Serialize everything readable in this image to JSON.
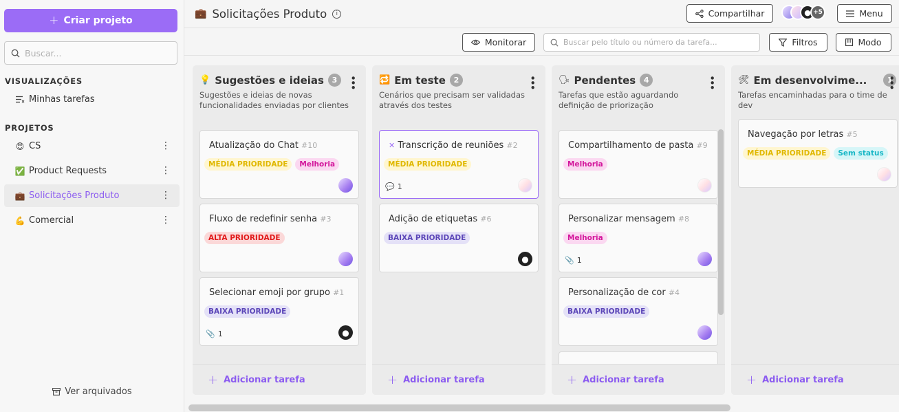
{
  "sidebar": {
    "create_label": "Criar projeto",
    "search_placeholder": "Buscar...",
    "views_label": "VISUALIZAÇÕES",
    "views": [
      {
        "label": "Minhas tarefas",
        "icon": "list-icon"
      }
    ],
    "projects_label": "PROJETOS",
    "projects": [
      {
        "label": "CS",
        "icon": "😍"
      },
      {
        "label": "Product Requests",
        "icon": "✅"
      },
      {
        "label": "Solicitações Produto",
        "icon": "💼",
        "active": true
      },
      {
        "label": "Comercial",
        "icon": "💪"
      }
    ],
    "archive_label": "Ver arquivados"
  },
  "header": {
    "title_icon": "💼",
    "title": "Solicitações Produto",
    "share_label": "Compartilhar",
    "more_members": "+5",
    "menu_label": "Menu"
  },
  "toolbar": {
    "monitor_label": "Monitorar",
    "search_placeholder": "Buscar pelo título ou número da tarefa...",
    "filters_label": "Filtros",
    "mode_label": "Modo"
  },
  "add_task_label": "Adicionar tarefa",
  "columns": [
    {
      "icon": "💡",
      "title": "Sugestões e ideias",
      "count": "3",
      "desc": "Sugestões e ideias de novas funcionalidades enviadas por clientes",
      "cards": [
        {
          "title": "Atualização do Chat",
          "num": "#10",
          "tags": [
            [
              "MÉDIA PRIORIDADE",
              "media"
            ],
            [
              "Melhoria",
              "melhoria"
            ]
          ]
        },
        {
          "title": "Fluxo de redefinir senha",
          "num": "#3",
          "tags": [
            [
              "ALTA PRIORIDADE",
              "alta"
            ]
          ]
        },
        {
          "title": "Selecionar emoji por grupo",
          "num": "#1",
          "tags": [
            [
              "BAIXA PRIORIDADE",
              "baixa"
            ]
          ],
          "attachments": "1"
        }
      ]
    },
    {
      "icon": "🔁",
      "title": "Em teste",
      "count": "2",
      "desc": "Cenários que precisam ser validadas através dos testes",
      "cards": [
        {
          "title": "Transcrição de reuniões",
          "num": "#2",
          "tags": [
            [
              "MÉDIA PRIORIDADE",
              "media"
            ]
          ],
          "comments": "1"
        },
        {
          "title": "Adição de etiquetas",
          "num": "#6",
          "tags": [
            [
              "BAIXA PRIORIDADE",
              "baixa"
            ]
          ]
        }
      ]
    },
    {
      "icon": "🗣",
      "title": "Pendentes",
      "count": "4",
      "desc": "Tarefas que estão aguardando definição de priorização",
      "cards": [
        {
          "title": "Compartilhamento de pasta",
          "num": "#9",
          "tags": [
            [
              "Melhoria",
              "melhoria"
            ]
          ]
        },
        {
          "title": "Personalizar mensagem",
          "num": "#8",
          "tags": [
            [
              "Melhoria",
              "melhoria"
            ]
          ],
          "attachments": "1"
        },
        {
          "title": "Personalização de cor",
          "num": "#4",
          "tags": [
            [
              "BAIXA PRIORIDADE",
              "baixa"
            ]
          ]
        }
      ]
    },
    {
      "icon": "🛠",
      "title": "Em desenvolvime...",
      "count": "1",
      "desc": "Tarefas encaminhadas para o time de dev",
      "cards": [
        {
          "title": "Navegação por letras",
          "num": "#5",
          "tags": [
            [
              "MÉDIA PRIORIDADE",
              "media"
            ],
            [
              "Sem status",
              "semstatus"
            ]
          ]
        }
      ]
    }
  ]
}
